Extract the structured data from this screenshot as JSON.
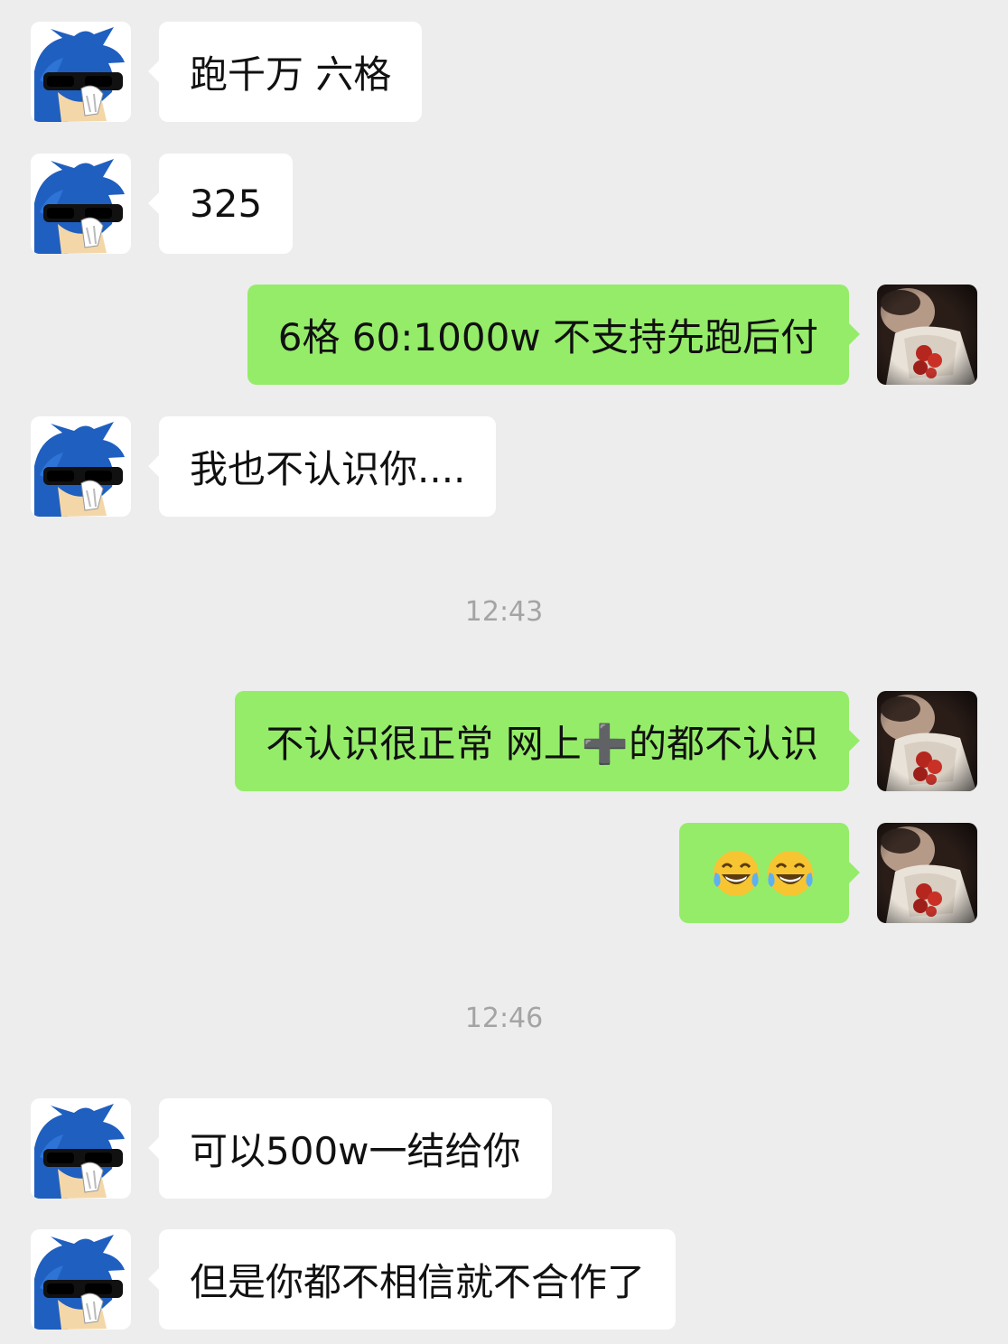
{
  "messages": [
    {
      "side": "in",
      "text": "跑千万 六格"
    },
    {
      "side": "in",
      "text": "325"
    },
    {
      "side": "out",
      "text": "6格 60:1000w 不支持先跑后付"
    },
    {
      "side": "in",
      "text": "我也不认识你...."
    },
    {
      "side": "time",
      "text": "12:43"
    },
    {
      "side": "out",
      "text": "不认识很正常 网上➕的都不认识"
    },
    {
      "side": "out",
      "emoji": [
        "face-with-tears-of-joy-icon",
        "face-with-tears-of-joy-icon"
      ]
    },
    {
      "side": "time",
      "text": "12:46"
    },
    {
      "side": "in",
      "text": "可以500w一结给你"
    },
    {
      "side": "in",
      "text": "但是你都不相信就不合作了"
    }
  ],
  "colors": {
    "background": "#ededed",
    "incoming_bubble": "#ffffff",
    "outgoing_bubble": "#95ec69",
    "timestamp_text": "#a4a4a4"
  }
}
